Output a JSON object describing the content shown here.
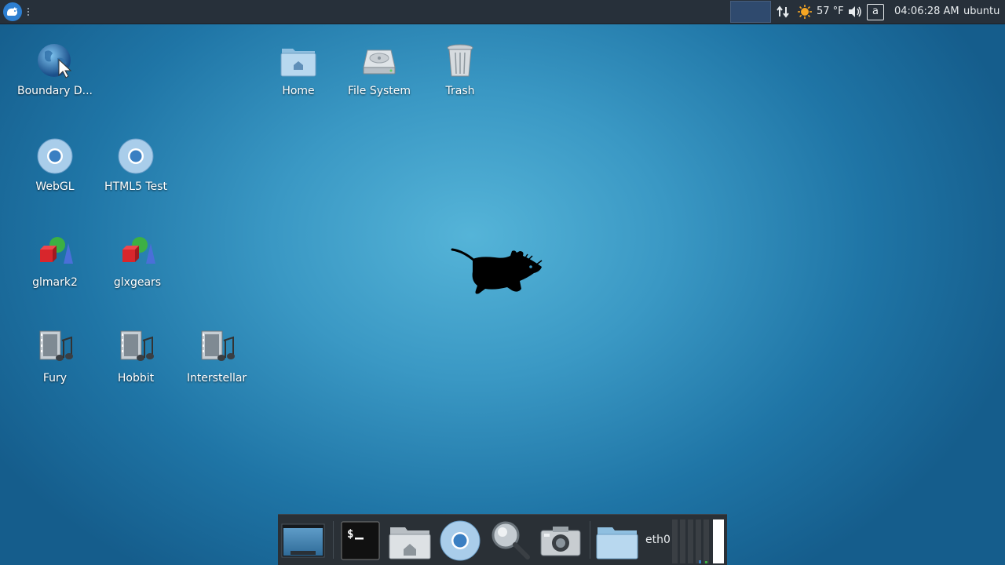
{
  "top_panel": {
    "menu_icon": "xfce-mouse-menu-icon",
    "workspace": "workspace-1",
    "network_icon": "network-updown-icon",
    "weather_icon": "sun-icon",
    "temperature": "57 °F",
    "volume_icon": "speaker-icon",
    "keyboard_layout": "a",
    "clock": "04:06:28 AM",
    "user": "ubuntu"
  },
  "desktop": {
    "icons": [
      {
        "label": "Boundary D...",
        "icon": "globe-icon"
      },
      {
        "label": "Home",
        "icon": "home-folder-icon"
      },
      {
        "label": "File System",
        "icon": "hard-drive-icon"
      },
      {
        "label": "Trash",
        "icon": "trash-icon"
      },
      {
        "label": "WebGL",
        "icon": "chromium-icon"
      },
      {
        "label": "HTML5 Test",
        "icon": "chromium-icon"
      },
      {
        "label": "glmark2",
        "icon": "3d-shapes-icon"
      },
      {
        "label": "glxgears",
        "icon": "3d-shapes-icon"
      },
      {
        "label": "Fury",
        "icon": "video-file-icon"
      },
      {
        "label": "Hobbit",
        "icon": "video-file-icon"
      },
      {
        "label": "Interstellar",
        "icon": "video-file-icon"
      }
    ]
  },
  "dock": {
    "items": [
      {
        "name": "show-desktop",
        "icon": "desktop-icon"
      },
      {
        "name": "terminal",
        "icon": "terminal-icon"
      },
      {
        "name": "file-manager",
        "icon": "home-folder-icon"
      },
      {
        "name": "web-browser",
        "icon": "chromium-icon"
      },
      {
        "name": "app-finder",
        "icon": "magnifier-icon"
      },
      {
        "name": "screenshot",
        "icon": "camera-icon"
      },
      {
        "name": "folder",
        "icon": "folder-icon"
      }
    ],
    "network_interface": "eth0"
  },
  "colors": {
    "panel": "#27303a",
    "accent": "#2d7ed0",
    "desktop_center": "#55b4d8",
    "desktop_edge": "#155d8c"
  }
}
